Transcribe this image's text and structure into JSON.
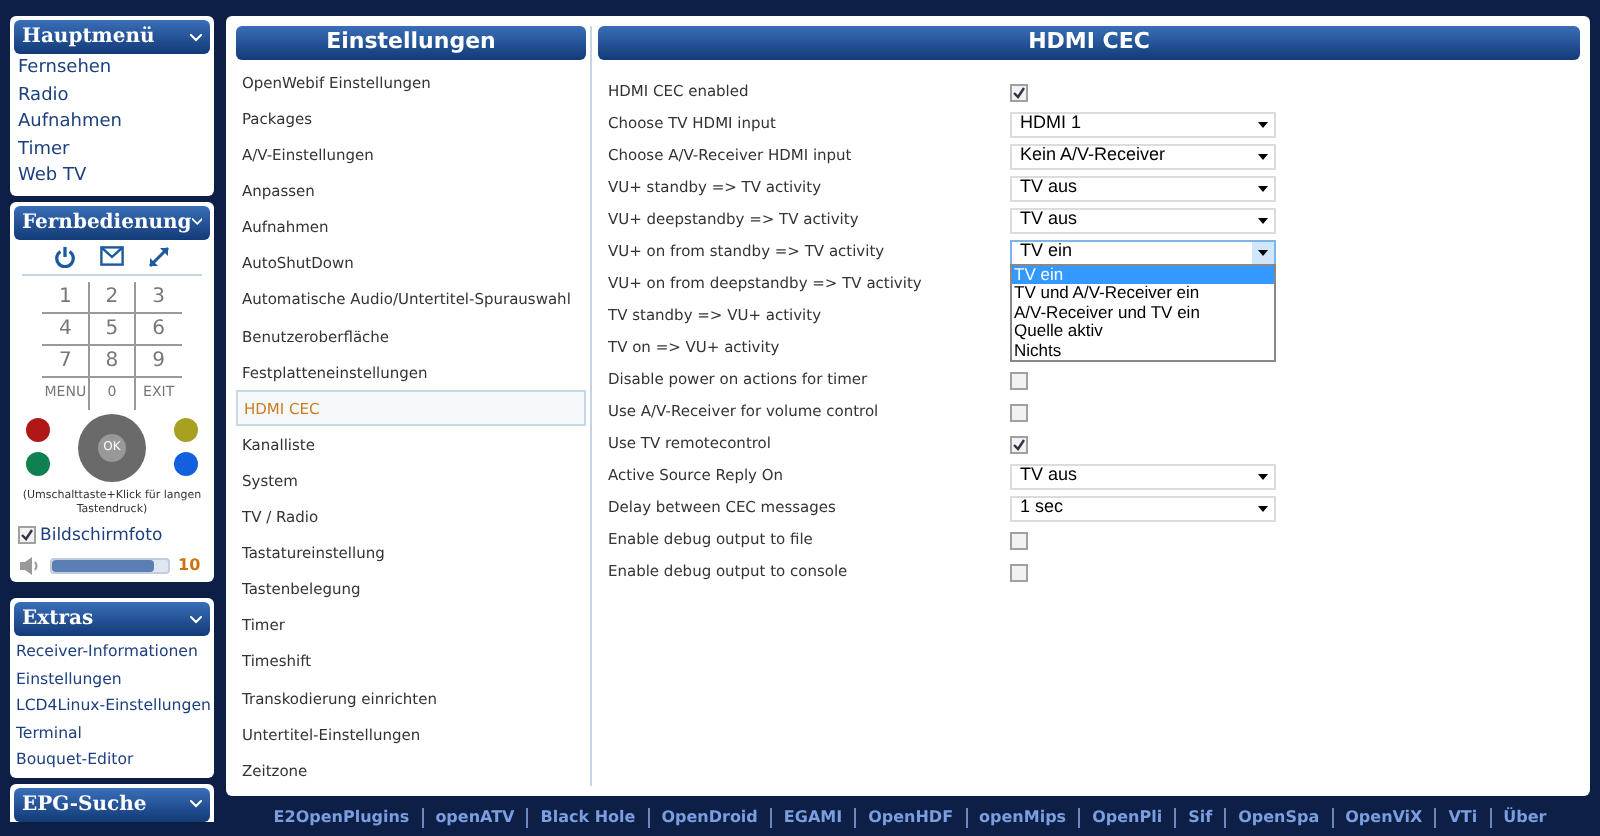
{
  "sidebar": {
    "main_menu": {
      "title": "Hauptmenü",
      "items": [
        "Fernsehen",
        "Radio",
        "Aufnahmen",
        "Timer",
        "Web TV"
      ]
    },
    "remote": {
      "title": "Fernbedienung",
      "keys": [
        "1",
        "2",
        "3",
        "4",
        "5",
        "6",
        "7",
        "8",
        "9",
        "MENU",
        "0",
        "EXIT"
      ],
      "ok": "OK",
      "color_keys": [
        {
          "color": "#b01818"
        },
        {
          "color": "#a8a020"
        },
        {
          "color": "#108050"
        },
        {
          "color": "#1060e0"
        }
      ],
      "hint": "(Umschalttaste+Klick für langen Tastendruck)",
      "screenshot": {
        "label": "Bildschirmfoto",
        "checked": true
      },
      "volume": {
        "level": 0.88,
        "reading": "10"
      }
    },
    "extras": {
      "title": "Extras",
      "items": [
        "Receiver-Informationen",
        "Einstellungen",
        "LCD4Linux-Einstellungen",
        "Terminal",
        "Bouquet-Editor"
      ]
    },
    "epg": {
      "title": "EPG-Suche"
    }
  },
  "settings": {
    "title": "Einstellungen",
    "items": [
      {
        "label": "OpenWebif Einstellungen",
        "selected": false
      },
      {
        "label": "Packages",
        "selected": false
      },
      {
        "label": "A/V-Einstellungen",
        "selected": false
      },
      {
        "label": "Anpassen",
        "selected": false
      },
      {
        "label": "Aufnahmen",
        "selected": false
      },
      {
        "label": "AutoShutDown",
        "selected": false
      },
      {
        "label": "Automatische Audio/Untertitel-Spurauswahl",
        "selected": false
      },
      {
        "label": "Benutzeroberfläche",
        "selected": false
      },
      {
        "label": "Festplatteneinstellungen",
        "selected": false
      },
      {
        "label": "HDMI CEC",
        "selected": true
      },
      {
        "label": "Kanalliste",
        "selected": false
      },
      {
        "label": "System",
        "selected": false
      },
      {
        "label": "TV / Radio",
        "selected": false
      },
      {
        "label": "Tastatureinstellung",
        "selected": false
      },
      {
        "label": "Tastenbelegung",
        "selected": false
      },
      {
        "label": "Timer",
        "selected": false
      },
      {
        "label": "Timeshift",
        "selected": false
      },
      {
        "label": "Transkodierung einrichten",
        "selected": false
      },
      {
        "label": "Untertitel-Einstellungen",
        "selected": false
      },
      {
        "label": "Zeitzone",
        "selected": false
      }
    ]
  },
  "panel": {
    "title": "HDMI CEC",
    "rows": [
      {
        "kind": "checkbox",
        "label": "HDMI CEC enabled",
        "checked": true
      },
      {
        "kind": "select",
        "label": "Choose TV HDMI input",
        "value": "HDMI 1"
      },
      {
        "kind": "select",
        "label": "Choose A/V-Receiver HDMI input",
        "value": "Kein A/V-Receiver"
      },
      {
        "kind": "select",
        "label": "VU+ standby => TV activity",
        "value": "TV aus"
      },
      {
        "kind": "select",
        "label": "VU+ deepstandby => TV activity",
        "value": "TV aus"
      },
      {
        "kind": "dropdown",
        "label": "VU+ on from standby => TV activity",
        "value": "TV ein",
        "options": [
          {
            "label": "TV ein",
            "selected": true
          },
          {
            "label": "TV und A/V-Receiver ein",
            "selected": false
          },
          {
            "label": "A/V-Receiver und TV ein",
            "selected": false
          },
          {
            "label": "Quelle aktiv",
            "selected": false
          },
          {
            "label": "Nichts",
            "selected": false
          }
        ]
      },
      {
        "kind": "covered",
        "label": "VU+ on from deepstandby => TV activity"
      },
      {
        "kind": "covered",
        "label": "TV standby => VU+ activity"
      },
      {
        "kind": "covered",
        "label": "TV on => VU+ activity"
      },
      {
        "kind": "checkbox",
        "label": "Disable power on actions for timer",
        "checked": false
      },
      {
        "kind": "checkbox",
        "label": "Use A/V-Receiver for volume control",
        "checked": false
      },
      {
        "kind": "checkbox",
        "label": "Use TV remotecontrol",
        "checked": true
      },
      {
        "kind": "select",
        "label": "Active Source Reply On",
        "value": "TV aus"
      },
      {
        "kind": "select",
        "label": "Delay between CEC messages",
        "value": "1 sec"
      },
      {
        "kind": "checkbox",
        "label": "Enable debug output to file",
        "checked": false
      },
      {
        "kind": "checkbox",
        "label": "Enable debug output to console",
        "checked": false
      }
    ]
  },
  "footer_links": [
    "E2OpenPlugins",
    "openATV",
    "Black Hole",
    "OpenDroid",
    "EGAMI",
    "OpenHDF",
    "openMips",
    "OpenPli",
    "Sif",
    "OpenSpa",
    "OpenViX",
    "VTi",
    "Über"
  ]
}
